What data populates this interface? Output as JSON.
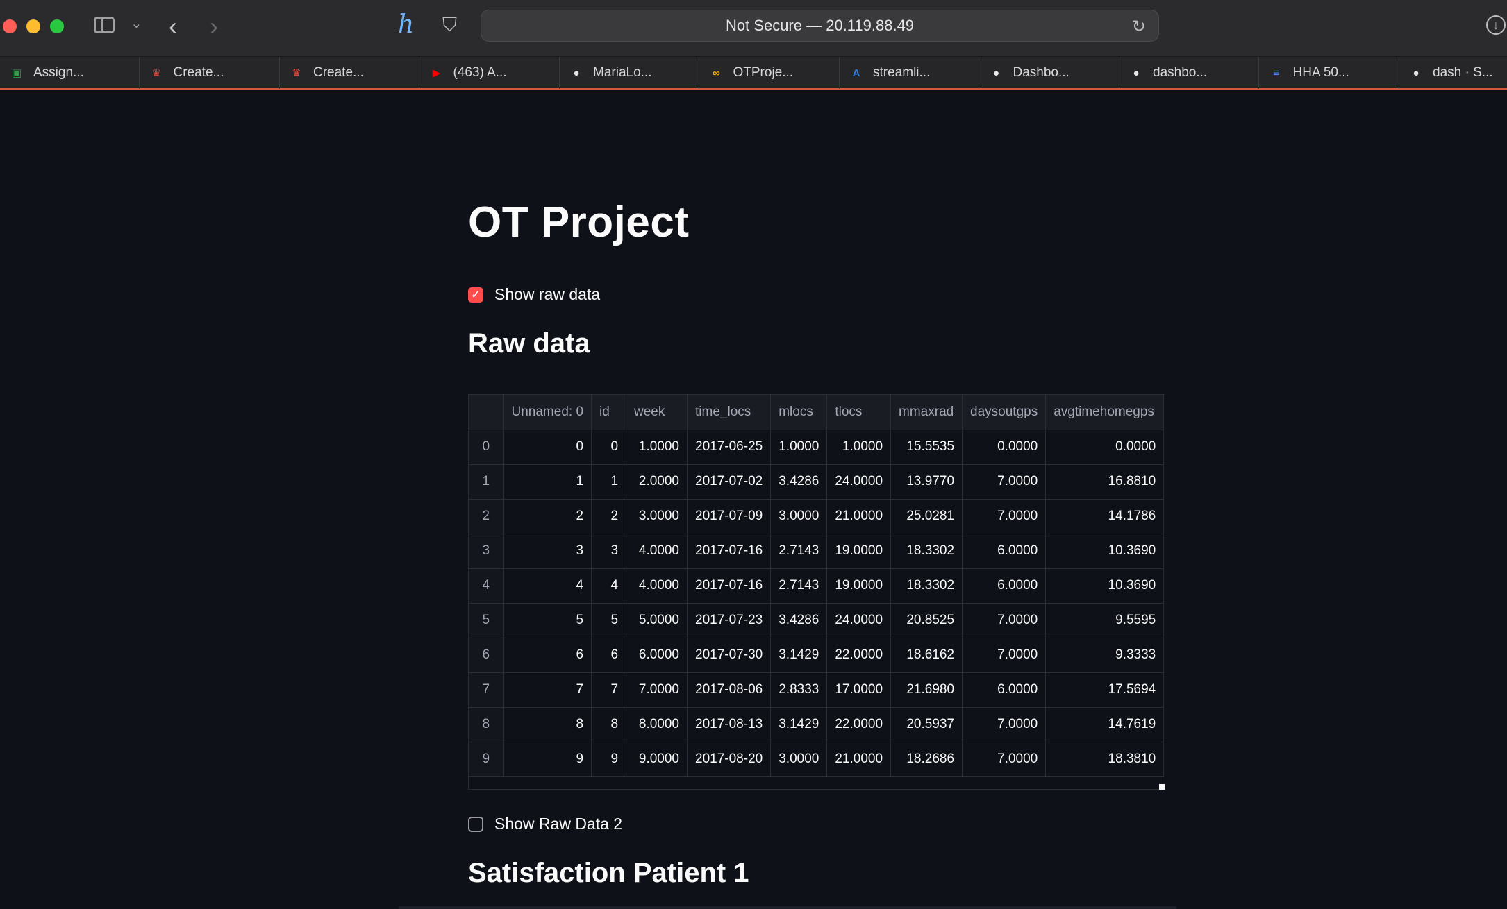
{
  "browser": {
    "address": "Not Secure — 20.119.88.49",
    "tabs": [
      {
        "label": "Assign...",
        "icon": "google-classroom-icon",
        "color": "#2e9c48"
      },
      {
        "label": "Create...",
        "icon": "crown-icon",
        "color": "#e0453a"
      },
      {
        "label": "Create...",
        "icon": "crown-icon",
        "color": "#e0453a"
      },
      {
        "label": "(463) A...",
        "icon": "youtube-icon",
        "color": "#ff0000"
      },
      {
        "label": "MariaLo...",
        "icon": "github-icon",
        "color": "#e6e6e6"
      },
      {
        "label": "OTProje...",
        "icon": "colab-icon",
        "color": "#f9ab00"
      },
      {
        "label": "streamli...",
        "icon": "azure-icon",
        "color": "#2f7bd8"
      },
      {
        "label": "Dashbo...",
        "icon": "github-icon",
        "color": "#e6e6e6"
      },
      {
        "label": "dashbo...",
        "icon": "github-icon",
        "color": "#e6e6e6"
      },
      {
        "label": "HHA 50...",
        "icon": "google-docs-icon",
        "color": "#4a86f0"
      },
      {
        "label": "dash · S...",
        "icon": "github-icon",
        "color": "#e6e6e6"
      }
    ]
  },
  "page": {
    "title": "OT Project",
    "checkbox1_label": "Show raw data",
    "checkbox1_checked": true,
    "section1_title": "Raw data",
    "checkbox2_label": "Show Raw Data 2",
    "checkbox2_checked": false,
    "section2_title": "Satisfaction Patient 1"
  },
  "table": {
    "columns": [
      "",
      "Unnamed: 0",
      "id",
      "week",
      "time_locs",
      "mlocs",
      "tlocs",
      "mmaxrad",
      "daysoutgps",
      "avgtimehomegps"
    ],
    "rows": [
      [
        "0",
        "0",
        "0",
        "1.0000",
        "2017-06-25",
        "1.0000",
        "1.0000",
        "15.5535",
        "0.0000",
        "0.0000"
      ],
      [
        "1",
        "1",
        "1",
        "2.0000",
        "2017-07-02",
        "3.4286",
        "24.0000",
        "13.9770",
        "7.0000",
        "16.8810"
      ],
      [
        "2",
        "2",
        "2",
        "3.0000",
        "2017-07-09",
        "3.0000",
        "21.0000",
        "25.0281",
        "7.0000",
        "14.1786"
      ],
      [
        "3",
        "3",
        "3",
        "4.0000",
        "2017-07-16",
        "2.7143",
        "19.0000",
        "18.3302",
        "6.0000",
        "10.3690"
      ],
      [
        "4",
        "4",
        "4",
        "4.0000",
        "2017-07-16",
        "2.7143",
        "19.0000",
        "18.3302",
        "6.0000",
        "10.3690"
      ],
      [
        "5",
        "5",
        "5",
        "5.0000",
        "2017-07-23",
        "3.4286",
        "24.0000",
        "20.8525",
        "7.0000",
        "9.5595"
      ],
      [
        "6",
        "6",
        "6",
        "6.0000",
        "2017-07-30",
        "3.1429",
        "22.0000",
        "18.6162",
        "7.0000",
        "9.3333"
      ],
      [
        "7",
        "7",
        "7",
        "7.0000",
        "2017-08-06",
        "2.8333",
        "17.0000",
        "21.6980",
        "6.0000",
        "17.5694"
      ],
      [
        "8",
        "8",
        "8",
        "8.0000",
        "2017-08-13",
        "3.1429",
        "22.0000",
        "20.5937",
        "7.0000",
        "14.7619"
      ],
      [
        "9",
        "9",
        "9",
        "9.0000",
        "2017-08-20",
        "3.0000",
        "21.0000",
        "18.2686",
        "7.0000",
        "18.3810"
      ]
    ]
  }
}
